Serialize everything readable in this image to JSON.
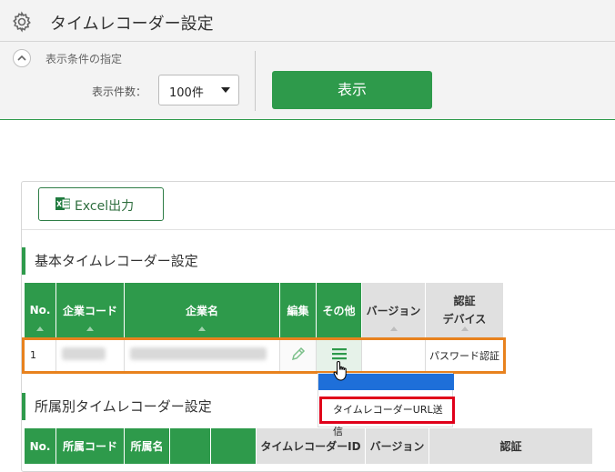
{
  "header": {
    "title": "タイムレコーダー設定",
    "icon": "gear-icon"
  },
  "filter": {
    "title": "表示条件の指定",
    "count_label": "表示件数：",
    "count_value": "100件",
    "show_button": "表示"
  },
  "toolbar": {
    "excel_label": "Excel出力"
  },
  "section1": {
    "title": "基本タイムレコーダー設定",
    "columns": [
      "No.",
      "企業コード",
      "企業名",
      "編集",
      "その他",
      "バージョン",
      "認証\nデバイス"
    ],
    "row": {
      "no": "1",
      "version": "",
      "auth_device": "パスワード認証"
    }
  },
  "popup": {
    "item_label": "タイムレコーダーURL送信"
  },
  "section2": {
    "title": "所属別タイムレコーダー設定",
    "columns": [
      "No.",
      "所属コード",
      "所属名",
      "",
      "",
      "タイムレコーダーID",
      "バージョン",
      "認証"
    ]
  },
  "colors": {
    "accent": "#2e9a4b",
    "highlight_orange": "#e8821e",
    "highlight_red": "#e0001a",
    "popup_blue": "#1e6fd9"
  }
}
